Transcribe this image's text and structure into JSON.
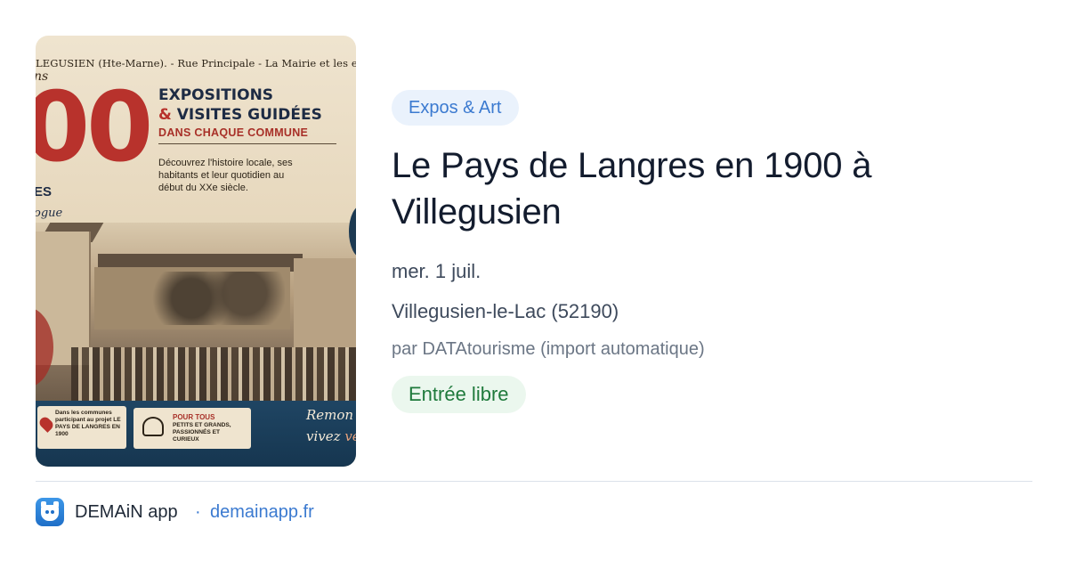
{
  "poster": {
    "caption": "LEGUSIEN (Hte-Marne). - Rue Principale - La Mairie et les enfant",
    "script_fragment": "ns",
    "big_number": "00",
    "side_fragment_1": "ES",
    "side_fragment_2": "ogue",
    "title_line1": "EXPOSITIONS",
    "title_line2_amp": "&",
    "title_line2": "VISITES GUIDÉES",
    "subtitle": "DANS CHAQUE COMMUNE",
    "description": "Découvrez l'histoire locale, ses habitants et leur quotidien au début du XXe siècle.",
    "box1_text": "Dans les communes participant au projet LE PAYS DE LANGRES EN 1900",
    "box2_title": "POUR TOUS",
    "box2_text": "PETITS ET GRANDS, PASSIONNÉS ET CURIEUX",
    "script_line1": "Remon",
    "script_line2": "vivez",
    "script_line2_accent": "ve"
  },
  "event": {
    "category": "Expos & Art",
    "title": "Le Pays de Langres en 1900 à Villegusien",
    "date": "mer. 1 juil.",
    "location": "Villegusien-le-Lac (52190)",
    "source": "par DATAtourisme (import automatique)",
    "price": "Entrée libre"
  },
  "footer": {
    "app_name": "DEMAiN app",
    "separator": "·",
    "domain": "demainapp.fr",
    "icon": "demain-app-icon"
  },
  "colors": {
    "accent_blue": "#3b7ad0",
    "category_bg": "#eaf2fc",
    "price_green": "#1f7a3c",
    "price_bg": "#ebf7ee",
    "title_text": "#131c2e"
  }
}
